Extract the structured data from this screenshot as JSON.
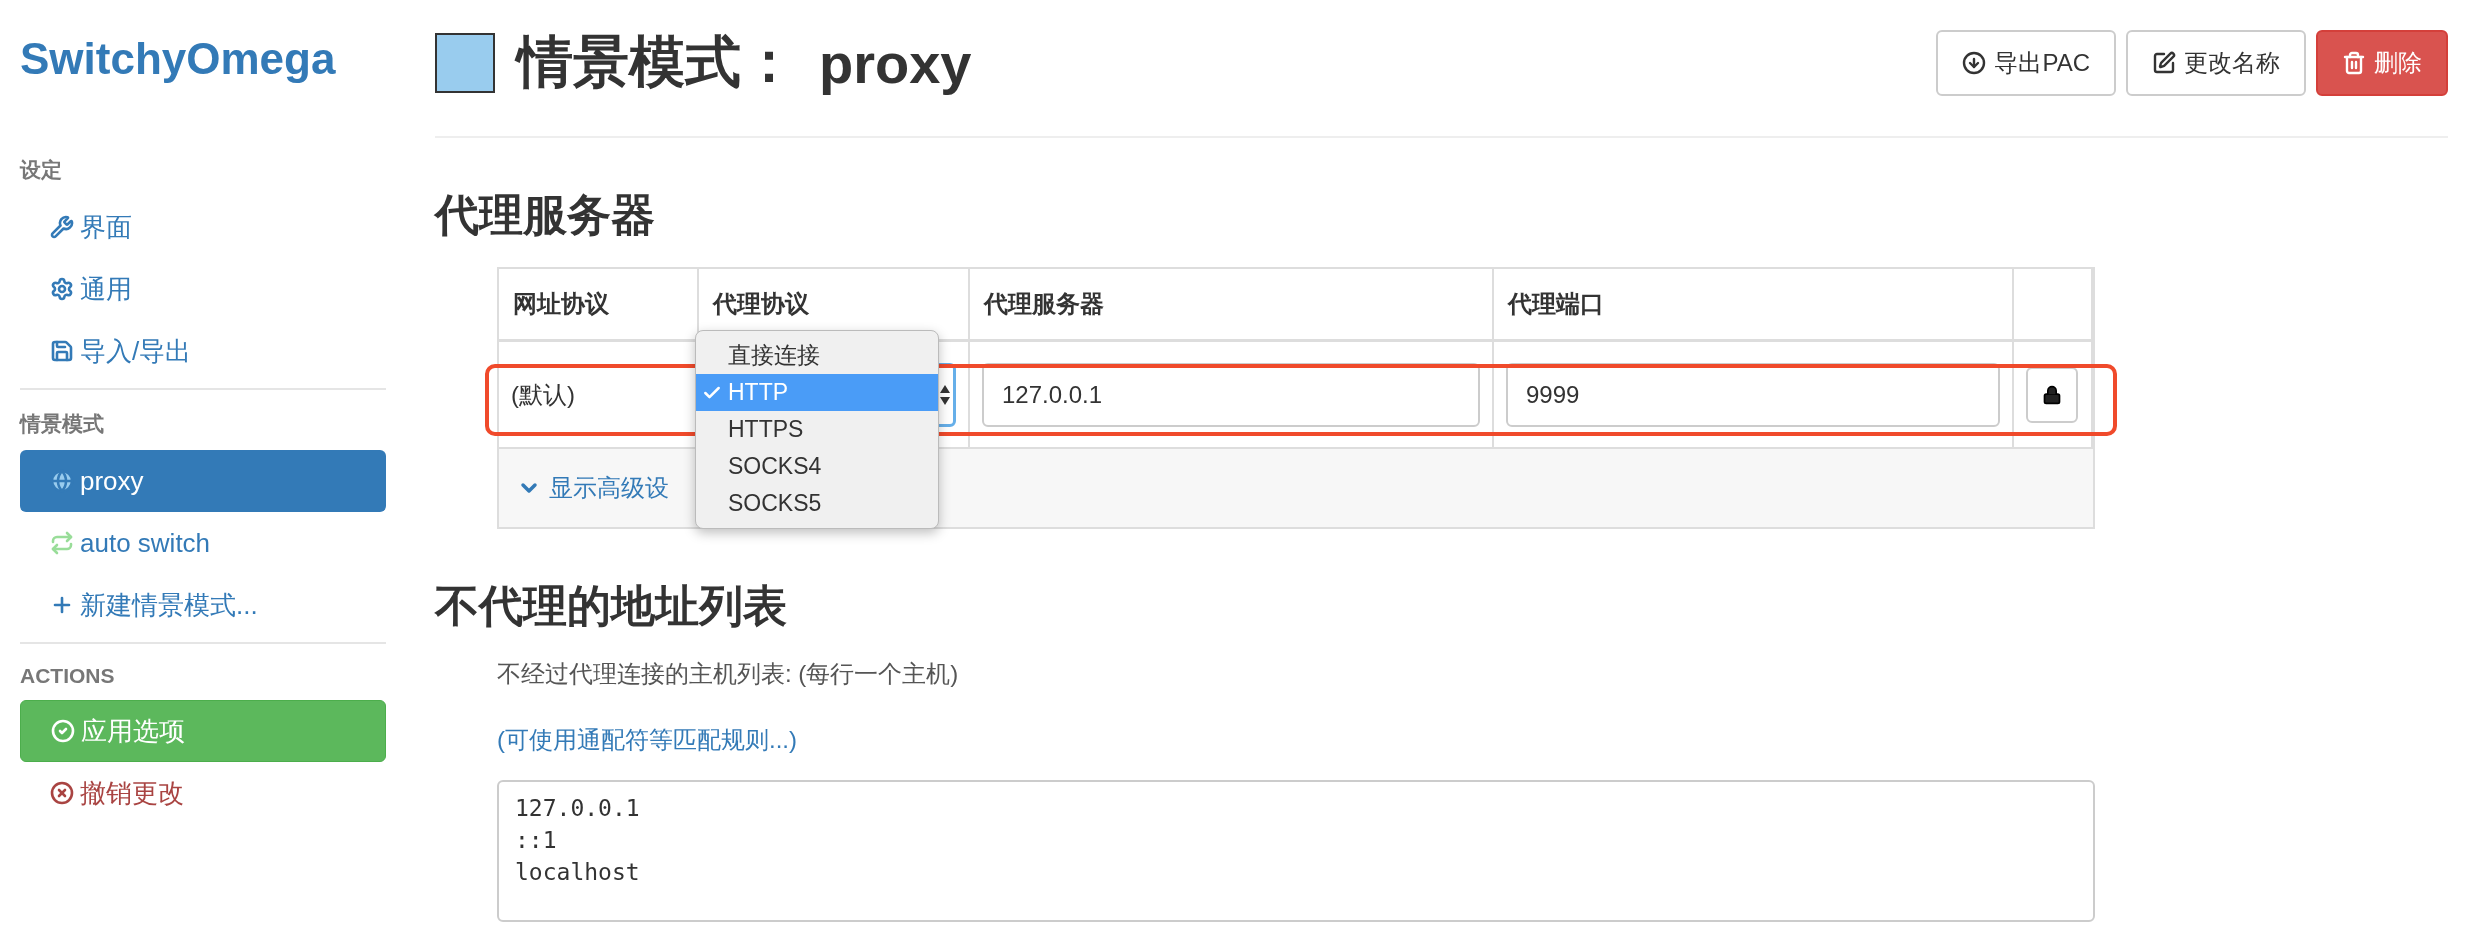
{
  "app_name": "SwitchyOmega",
  "sidebar": {
    "sections": [
      {
        "heading": "设定",
        "items": [
          {
            "label": "界面",
            "selected": false
          },
          {
            "label": "通用",
            "selected": false
          },
          {
            "label": "导入/导出",
            "selected": false
          }
        ]
      },
      {
        "heading": "情景模式",
        "items": [
          {
            "label": "proxy",
            "selected": true,
            "color": "#99ccee"
          },
          {
            "label": "auto switch",
            "selected": false,
            "color": "#99dd99"
          },
          {
            "label": "新建情景模式...",
            "selected": false
          }
        ]
      },
      {
        "heading": "ACTIONS",
        "items": [
          {
            "label": "应用选项",
            "kind": "apply"
          },
          {
            "label": "撤销更改",
            "kind": "discard"
          }
        ]
      }
    ]
  },
  "header": {
    "color": "#99ccee",
    "title_label": "情景模式：",
    "profile_name": "proxy",
    "buttons": [
      {
        "label": "导出PAC",
        "kind": "export"
      },
      {
        "label": "更改名称",
        "kind": "rename"
      },
      {
        "label": "删除",
        "kind": "delete"
      }
    ]
  },
  "proxy_servers": {
    "heading": "代理服务器",
    "columns": [
      "网址协议",
      "代理协议",
      "代理服务器",
      "代理端口"
    ],
    "row": {
      "highlighted": true,
      "scheme": "(默认)",
      "server": "127.0.0.1",
      "port": "9999",
      "protocol_options": [
        {
          "label": "直接连接",
          "selected": false
        },
        {
          "label": "HTTP",
          "selected": true
        },
        {
          "label": "HTTPS",
          "selected": false
        },
        {
          "label": "SOCKS4",
          "selected": false
        },
        {
          "label": "SOCKS5",
          "selected": false
        }
      ]
    },
    "advanced_link": "显示高级设"
  },
  "bypass": {
    "heading": "不代理的地址列表",
    "description": "不经过代理连接的主机列表: (每行一个主机)",
    "link": "(可使用通配符等匹配规则...)",
    "lines": [
      "127.0.0.1",
      "::1",
      "localhost"
    ]
  }
}
